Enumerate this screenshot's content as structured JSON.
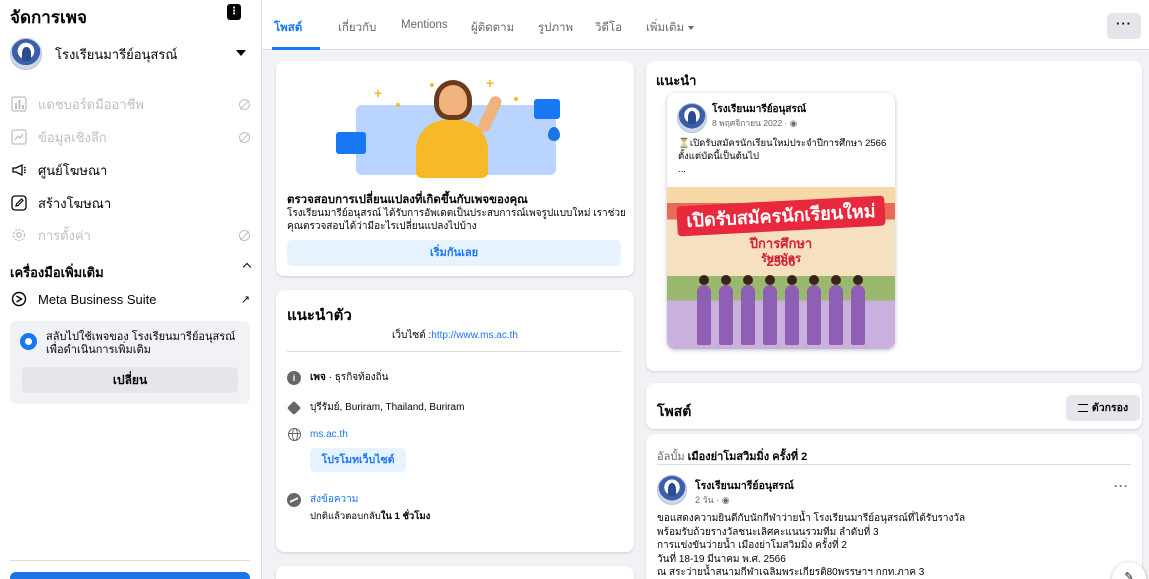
{
  "sidebar": {
    "title": "จัดการเพจ",
    "page_name": "โรงเรียนมารีย์อนุสรณ์",
    "items": [
      {
        "label": "แดชบอร์ดมืออาชีพ",
        "disabled": true,
        "icon": "dashboard-icon"
      },
      {
        "label": "ข้อมูลเชิงลึก",
        "disabled": true,
        "icon": "insights-icon"
      },
      {
        "label": "ศูนย์โฆษณา",
        "disabled": false,
        "icon": "megaphone-icon"
      },
      {
        "label": "สร้างโฆษณา",
        "disabled": false,
        "icon": "pencil-icon"
      },
      {
        "label": "การตั้งค่า",
        "disabled": true,
        "icon": "gear-icon"
      }
    ],
    "more_tools_label": "เครื่องมือเพิ่มเติม",
    "meta_label": "Meta Business Suite",
    "switch_text": "สลับไปใช้เพจของ โรงเรียนมารีย์อนุสรณ์ เพื่อดำเนินการเพิ่มเติม",
    "switch_button": "เปลี่ยน"
  },
  "tabs": [
    {
      "label": "โพสต์",
      "active": true
    },
    {
      "label": "เกี่ยวกับ",
      "active": false
    },
    {
      "label": "Mentions",
      "active": false
    },
    {
      "label": "ผู้ติดตาม",
      "active": false
    },
    {
      "label": "รูปภาพ",
      "active": false
    },
    {
      "label": "วิดีโอ",
      "active": false
    },
    {
      "label": "เพิ่มเติม",
      "active": false
    }
  ],
  "top_more": "···",
  "changes_card": {
    "heading": "ตรวจสอบการเปลี่ยนแปลงที่เกิดขึ้นกับเพจของคุณ",
    "body": "โรงเรียนมารีย์อนุสรณ์ ได้รับการอัพเดตเป็นประสบการณ์เพจรูปแบบใหม่ เราช่วยคุณตรวจสอบได้ว่ามีอะไรเปลี่ยนแปลงไปบ้าง",
    "button": "เริ่มกันเลย"
  },
  "intro": {
    "title": "แนะนำตัว",
    "website_prefix": "เว็บไซต์ :",
    "website_url": "http://www.ms.ac.th",
    "category_bold": "เพจ",
    "category_rest": " · ธุรกิจท้องถิ่น",
    "location": "บุรีรัมย์, Buriram, Thailand, Buriram",
    "domain": "ms.ac.th",
    "promote_button": "โปรโมทเว็บไซต์",
    "message_label": "ส่งข้อความ",
    "response_prefix": "ปกติแล้วตอบกลับ",
    "response_time": "ใน 1 ชั่วโมง"
  },
  "recommend": {
    "title": "แนะนำ",
    "post_author": "โรงเรียนมารีย์อนุสรณ์",
    "post_date": "8 พฤศจิกายน 2022 · ",
    "post_text": "⏳เปิดรับสมัครนักเรียนใหม่ประจำปีการศึกษา 2566 ตั้งแต่บัดนี้เป็นต้นไป",
    "post_ellipsis": "...",
    "banner_main": "เปิดรับสมัครนักเรียนใหม่",
    "banner_year": "ปีการศึกษา 2566",
    "banner_apply": "รับสมัคร"
  },
  "posts": {
    "title": "โพสต์",
    "filter_button": "ตัวกรอง",
    "album_prefix": "อัลบั้ม ",
    "album_name": "เมืองย่าโมสวิมมิ่ง ครั้งที่ 2",
    "author": "โรงเรียนมารีย์อนุสรณ์",
    "date": "2 วัน · ",
    "text_lines": [
      "ขอแสดงความยินดีกับนักกีฬาว่ายน้ำ โรงเรียนมารีย์อนุสรณ์ที่ได้รับรางวัล",
      "พร้อมรับถ้วยรางวัลชนะเลิศคะแนนรวมทีม ลำดับที่ 3",
      "การแข่งขันว่ายน้ำ เมืองย่าโมสวิมมิ่ง ครั้งที่ 2",
      "วันที่ 18-19 มีนาคม พ.ศ. 2566",
      "ณ สระว่ายน้ำสนามกีฬาเฉลิมพระเกียรติ80พรรษาฯ กกท.ภาค 3"
    ],
    "more": "···"
  }
}
